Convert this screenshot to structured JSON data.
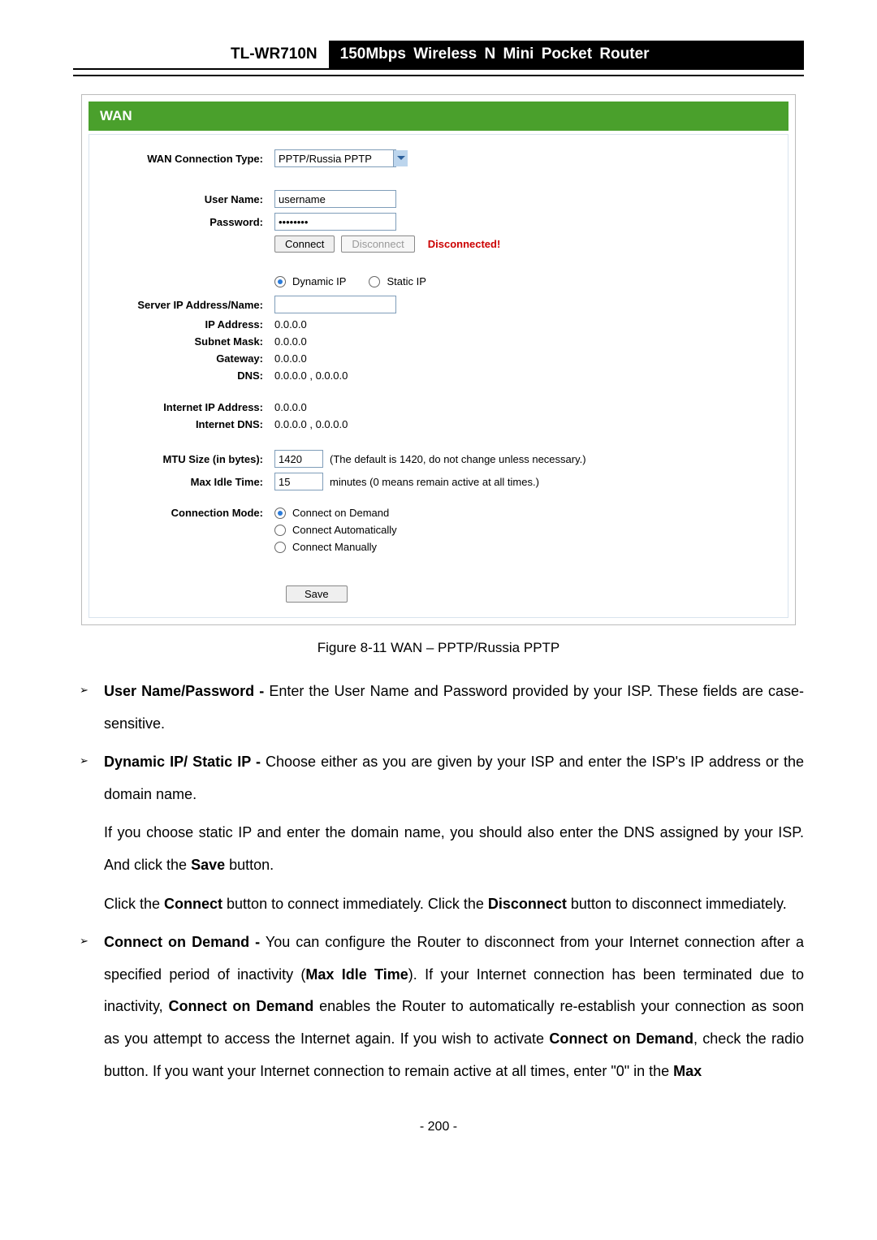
{
  "header": {
    "model": "TL-WR710N",
    "desc": "150Mbps Wireless N Mini Pocket Router"
  },
  "figure": {
    "title": "WAN",
    "wan_conn_type_label": "WAN Connection Type:",
    "wan_conn_type_value": "PPTP/Russia PPTP",
    "username_label": "User Name:",
    "username_value": "username",
    "password_label": "Password:",
    "password_value": "••••••••",
    "connect_btn": "Connect",
    "disconnect_btn": "Disconnect",
    "status": "Disconnected!",
    "dynamic_ip": "Dynamic IP",
    "static_ip": "Static IP",
    "server_ip_label": "Server IP Address/Name:",
    "server_ip_value": "",
    "ip_addr_label": "IP Address:",
    "ip_addr_value": "0.0.0.0",
    "subnet_label": "Subnet Mask:",
    "subnet_value": "0.0.0.0",
    "gateway_label": "Gateway:",
    "gateway_value": "0.0.0.0",
    "dns_label": "DNS:",
    "dns_value": "0.0.0.0 , 0.0.0.0",
    "internet_ip_label": "Internet IP Address:",
    "internet_ip_value": "0.0.0.0",
    "internet_dns_label": "Internet DNS:",
    "internet_dns_value": "0.0.0.0 , 0.0.0.0",
    "mtu_label": "MTU Size (in bytes):",
    "mtu_value": "1420",
    "mtu_note": "(The default is 1420, do not change unless necessary.)",
    "max_idle_label": "Max Idle Time:",
    "max_idle_value": "15",
    "max_idle_note": "minutes (0 means remain active at all times.)",
    "conn_mode_label": "Connection Mode:",
    "conn_mode_opts": {
      "demand": "Connect on Demand",
      "auto": "Connect Automatically",
      "manual": "Connect Manually"
    },
    "save_btn": "Save"
  },
  "caption": "Figure 8-11    WAN – PPTP/Russia PPTP",
  "bullets": {
    "b1_strong": "User Name/Password -",
    "b1_text": " Enter the User Name and Password provided by your ISP. These fields are case-sensitive.",
    "b2_strong": "Dynamic IP/ Static IP -",
    "b2_text": " Choose either as you are given by your ISP and enter the ISP's IP address or the domain name.",
    "b2_p2a": "If you choose static IP and enter the domain name, you should also enter the DNS assigned by your ISP. And click the ",
    "b2_p2b_strong": "Save",
    "b2_p2c": " button.",
    "b2_p3a": "Click the ",
    "b2_p3b_strong": "Connect",
    "b2_p3c": " button to connect immediately. Click the ",
    "b2_p3d_strong": "Disconnect",
    "b2_p3e": " button to disconnect immediately.",
    "b3_strong": "Connect on Demand -",
    "b3_a": " You can configure the Router to disconnect from your Internet connection after a specified period of inactivity (",
    "b3_b_strong": "Max Idle Time",
    "b3_c": "). If your Internet connection has been terminated due to inactivity, ",
    "b3_d_strong": "Connect on Demand",
    "b3_e": " enables the Router to automatically re-establish your connection as soon as you attempt to access the Internet again. If you wish to activate ",
    "b3_f_strong": "Connect on Demand",
    "b3_g": ", check the radio button. If you want your Internet connection to remain active at all times, enter \"0\" in the ",
    "b3_h_strong": "Max"
  },
  "page_number": "- 200 -"
}
